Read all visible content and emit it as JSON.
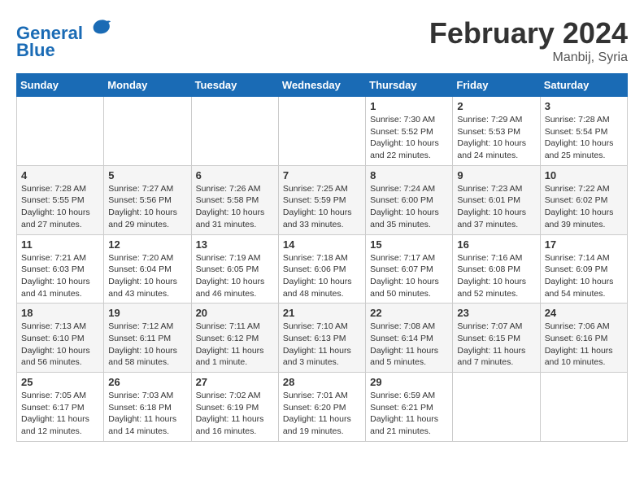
{
  "header": {
    "logo_line1": "General",
    "logo_line2": "Blue",
    "month": "February 2024",
    "location": "Manbij, Syria"
  },
  "weekdays": [
    "Sunday",
    "Monday",
    "Tuesday",
    "Wednesday",
    "Thursday",
    "Friday",
    "Saturday"
  ],
  "weeks": [
    [
      {
        "day": "",
        "info": ""
      },
      {
        "day": "",
        "info": ""
      },
      {
        "day": "",
        "info": ""
      },
      {
        "day": "",
        "info": ""
      },
      {
        "day": "1",
        "info": "Sunrise: 7:30 AM\nSunset: 5:52 PM\nDaylight: 10 hours\nand 22 minutes."
      },
      {
        "day": "2",
        "info": "Sunrise: 7:29 AM\nSunset: 5:53 PM\nDaylight: 10 hours\nand 24 minutes."
      },
      {
        "day": "3",
        "info": "Sunrise: 7:28 AM\nSunset: 5:54 PM\nDaylight: 10 hours\nand 25 minutes."
      }
    ],
    [
      {
        "day": "4",
        "info": "Sunrise: 7:28 AM\nSunset: 5:55 PM\nDaylight: 10 hours\nand 27 minutes."
      },
      {
        "day": "5",
        "info": "Sunrise: 7:27 AM\nSunset: 5:56 PM\nDaylight: 10 hours\nand 29 minutes."
      },
      {
        "day": "6",
        "info": "Sunrise: 7:26 AM\nSunset: 5:58 PM\nDaylight: 10 hours\nand 31 minutes."
      },
      {
        "day": "7",
        "info": "Sunrise: 7:25 AM\nSunset: 5:59 PM\nDaylight: 10 hours\nand 33 minutes."
      },
      {
        "day": "8",
        "info": "Sunrise: 7:24 AM\nSunset: 6:00 PM\nDaylight: 10 hours\nand 35 minutes."
      },
      {
        "day": "9",
        "info": "Sunrise: 7:23 AM\nSunset: 6:01 PM\nDaylight: 10 hours\nand 37 minutes."
      },
      {
        "day": "10",
        "info": "Sunrise: 7:22 AM\nSunset: 6:02 PM\nDaylight: 10 hours\nand 39 minutes."
      }
    ],
    [
      {
        "day": "11",
        "info": "Sunrise: 7:21 AM\nSunset: 6:03 PM\nDaylight: 10 hours\nand 41 minutes."
      },
      {
        "day": "12",
        "info": "Sunrise: 7:20 AM\nSunset: 6:04 PM\nDaylight: 10 hours\nand 43 minutes."
      },
      {
        "day": "13",
        "info": "Sunrise: 7:19 AM\nSunset: 6:05 PM\nDaylight: 10 hours\nand 46 minutes."
      },
      {
        "day": "14",
        "info": "Sunrise: 7:18 AM\nSunset: 6:06 PM\nDaylight: 10 hours\nand 48 minutes."
      },
      {
        "day": "15",
        "info": "Sunrise: 7:17 AM\nSunset: 6:07 PM\nDaylight: 10 hours\nand 50 minutes."
      },
      {
        "day": "16",
        "info": "Sunrise: 7:16 AM\nSunset: 6:08 PM\nDaylight: 10 hours\nand 52 minutes."
      },
      {
        "day": "17",
        "info": "Sunrise: 7:14 AM\nSunset: 6:09 PM\nDaylight: 10 hours\nand 54 minutes."
      }
    ],
    [
      {
        "day": "18",
        "info": "Sunrise: 7:13 AM\nSunset: 6:10 PM\nDaylight: 10 hours\nand 56 minutes."
      },
      {
        "day": "19",
        "info": "Sunrise: 7:12 AM\nSunset: 6:11 PM\nDaylight: 10 hours\nand 58 minutes."
      },
      {
        "day": "20",
        "info": "Sunrise: 7:11 AM\nSunset: 6:12 PM\nDaylight: 11 hours\nand 1 minute."
      },
      {
        "day": "21",
        "info": "Sunrise: 7:10 AM\nSunset: 6:13 PM\nDaylight: 11 hours\nand 3 minutes."
      },
      {
        "day": "22",
        "info": "Sunrise: 7:08 AM\nSunset: 6:14 PM\nDaylight: 11 hours\nand 5 minutes."
      },
      {
        "day": "23",
        "info": "Sunrise: 7:07 AM\nSunset: 6:15 PM\nDaylight: 11 hours\nand 7 minutes."
      },
      {
        "day": "24",
        "info": "Sunrise: 7:06 AM\nSunset: 6:16 PM\nDaylight: 11 hours\nand 10 minutes."
      }
    ],
    [
      {
        "day": "25",
        "info": "Sunrise: 7:05 AM\nSunset: 6:17 PM\nDaylight: 11 hours\nand 12 minutes."
      },
      {
        "day": "26",
        "info": "Sunrise: 7:03 AM\nSunset: 6:18 PM\nDaylight: 11 hours\nand 14 minutes."
      },
      {
        "day": "27",
        "info": "Sunrise: 7:02 AM\nSunset: 6:19 PM\nDaylight: 11 hours\nand 16 minutes."
      },
      {
        "day": "28",
        "info": "Sunrise: 7:01 AM\nSunset: 6:20 PM\nDaylight: 11 hours\nand 19 minutes."
      },
      {
        "day": "29",
        "info": "Sunrise: 6:59 AM\nSunset: 6:21 PM\nDaylight: 11 hours\nand 21 minutes."
      },
      {
        "day": "",
        "info": ""
      },
      {
        "day": "",
        "info": ""
      }
    ]
  ]
}
